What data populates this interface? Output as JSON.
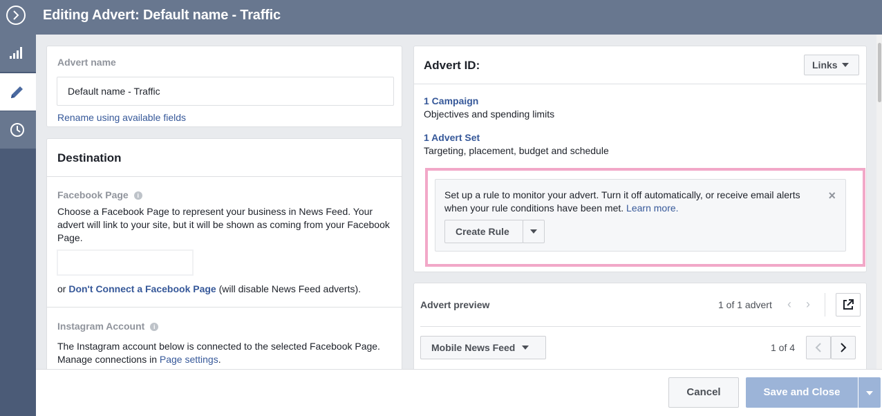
{
  "header": {
    "title": "Editing Advert: Default name - Traffic"
  },
  "rail": {
    "items": [
      {
        "icon": "bar-chart-icon"
      },
      {
        "icon": "pencil-icon",
        "active": true
      },
      {
        "icon": "clock-icon"
      }
    ]
  },
  "advert_name": {
    "label": "Advert name",
    "value": "Default name - Traffic",
    "rename_link": "Rename using available fields"
  },
  "destination": {
    "title": "Destination",
    "facebook_page_label": "Facebook Page",
    "facebook_page_desc": "Choose a Facebook Page to represent your business in News Feed. Your advert will link to your site, but it will be shown as coming from your Facebook Page.",
    "or_text": "or ",
    "dont_connect_link": "Don't Connect a Facebook Page",
    "dont_connect_suffix": " (will disable News Feed adverts).",
    "instagram_label": "Instagram Account",
    "instagram_desc": "The Instagram account below is connected to the selected Facebook Page. Manage connections in ",
    "page_settings_link": "Page settings",
    "instagram_desc_end": "."
  },
  "advert_id": {
    "title": "Advert ID:",
    "links_button": "Links",
    "campaign_link": "1 Campaign",
    "campaign_desc": "Objectives and spending limits",
    "advert_set_link": "1 Advert Set",
    "advert_set_desc": "Targeting, placement, budget and schedule",
    "rule_text": "Set up a rule to monitor your advert. Turn it off automatically, or receive email alerts when your rule conditions have been met. ",
    "learn_more": "Learn more.",
    "create_rule": "Create Rule",
    "close_symbol": "×"
  },
  "preview": {
    "title": "Advert preview",
    "count": "1 of 1 advert",
    "placement": "Mobile News Feed",
    "page_count": "1 of 4"
  },
  "footer": {
    "cancel": "Cancel",
    "save_close": "Save and Close"
  },
  "colors": {
    "header": "#68778f",
    "rail": "#4b5b77",
    "link": "#365899",
    "highlight": "#f2a8c8",
    "save_button": "#9cb4d8"
  }
}
